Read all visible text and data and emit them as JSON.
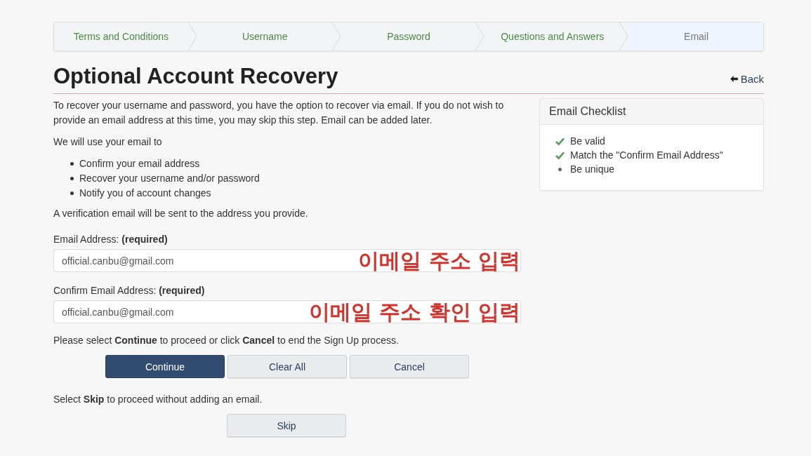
{
  "steps": [
    {
      "label": "Terms and Conditions",
      "selected": false
    },
    {
      "label": "Username",
      "selected": false
    },
    {
      "label": "Password",
      "selected": false
    },
    {
      "label": "Questions and Answers",
      "selected": false
    },
    {
      "label": "Email",
      "selected": true
    }
  ],
  "title": "Optional Account Recovery",
  "back_link": "Back",
  "intro": "To recover your username and password, you have the option to recover via email. If you do not wish to provide an email address at this time, you may skip this step. Email can be added later.",
  "use_heading": "We will use your email to",
  "uses": [
    "Confirm your email address",
    "Recover your username and/or password",
    "Notify you of account changes"
  ],
  "verification_note": "A verification email will be sent to the address you provide.",
  "fields": [
    {
      "label": "Email Address: **(required)**",
      "value": "official.canbu@gmail.com",
      "annotation": "이메일 주소 입력"
    },
    {
      "label": "Confirm Email Address: **(required)**",
      "value": "official.canbu@gmail.com",
      "annotation": "이메일 주소 확인 입력"
    }
  ],
  "continue_note": "Please select **Continue** to proceed or click **Cancel** to end the Sign Up process.",
  "buttons": [
    {
      "label": "Continue",
      "kind": "primary"
    },
    {
      "label": "Clear All",
      "kind": "secondary"
    },
    {
      "label": "Cancel",
      "kind": "secondary"
    }
  ],
  "skip_note": "Select **Skip** to proceed without adding an email.",
  "skip_button": "Skip",
  "checklist": {
    "title": "Email Checklist",
    "items": [
      {
        "label": "Be valid",
        "checked": true
      },
      {
        "label": "Match the \"Confirm Email Address\"",
        "checked": true
      },
      {
        "label": "Be unique",
        "checked": false
      }
    ]
  }
}
